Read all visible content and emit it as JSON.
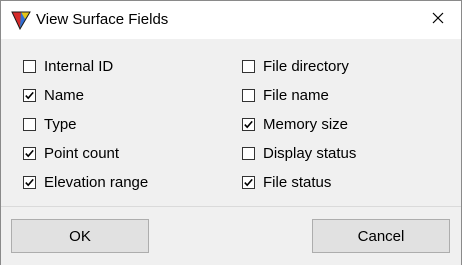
{
  "window": {
    "title": "View Surface Fields",
    "app_icon": "colored-triangle-icon",
    "close_icon": "close-icon"
  },
  "fields": {
    "left": [
      {
        "label": "Internal ID",
        "checked": false
      },
      {
        "label": "Name",
        "checked": true
      },
      {
        "label": "Type",
        "checked": false
      },
      {
        "label": "Point count",
        "checked": true
      },
      {
        "label": "Elevation range",
        "checked": true
      }
    ],
    "right": [
      {
        "label": "File directory",
        "checked": false
      },
      {
        "label": "File name",
        "checked": false
      },
      {
        "label": "Memory size",
        "checked": true
      },
      {
        "label": "Display status",
        "checked": false
      },
      {
        "label": "File status",
        "checked": true
      }
    ]
  },
  "buttons": {
    "ok_label": "OK",
    "cancel_label": "Cancel"
  }
}
